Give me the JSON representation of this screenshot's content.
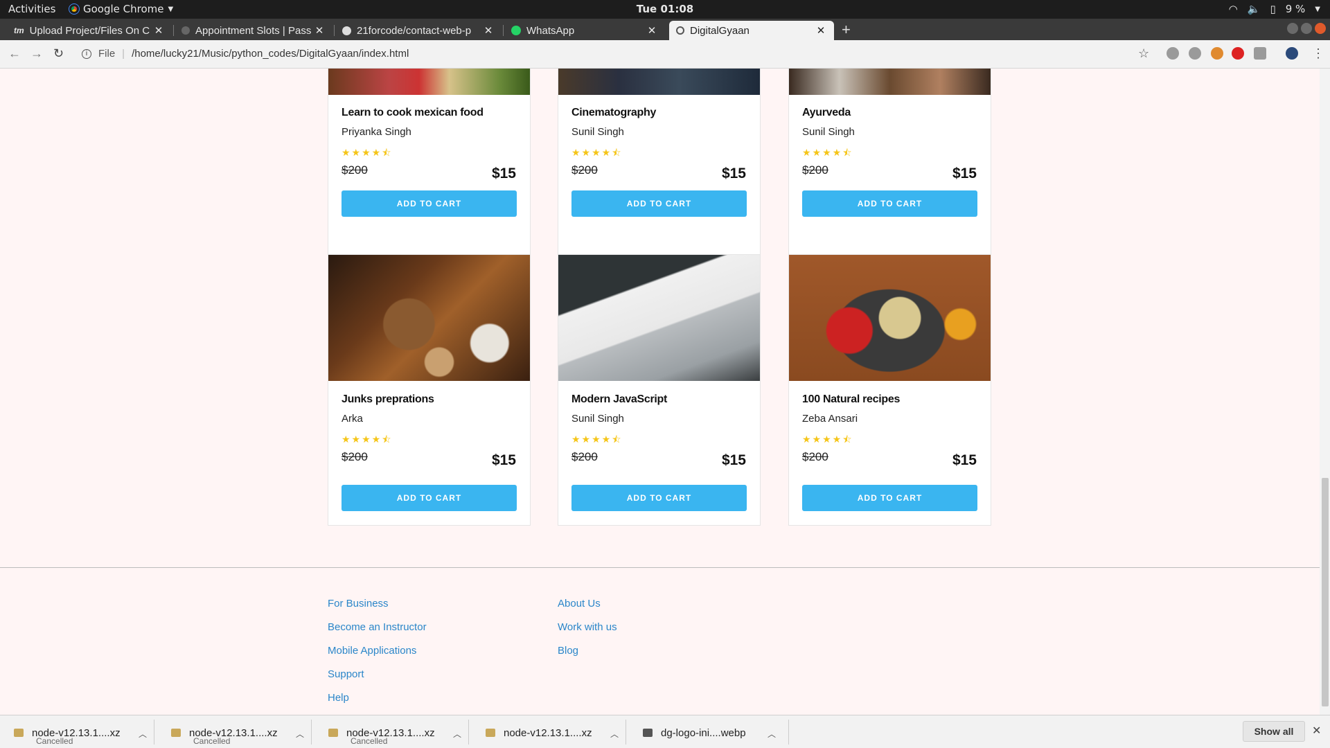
{
  "system": {
    "activities": "Activities",
    "app_name": "Google Chrome",
    "clock": "Tue 01:08",
    "battery": "9 %"
  },
  "tabs": [
    {
      "title": "Upload Project/Files On C",
      "icon": "tm-icon"
    },
    {
      "title": "Appointment Slots | Pass",
      "icon": "globe-icon"
    },
    {
      "title": "21forcode/contact-web-p",
      "icon": "github-icon"
    },
    {
      "title": "WhatsApp",
      "icon": "whatsapp-icon"
    },
    {
      "title": "DigitalGyaan",
      "icon": "globe-icon",
      "active": true
    }
  ],
  "address": {
    "scheme": "File",
    "path": "/home/lucky21/Music/python_codes/DigitalGyaan/index.html"
  },
  "courses": [
    {
      "title": "Learn to cook mexican food",
      "author": "Priyanka Singh",
      "rating": 4.5,
      "old_price": "$200",
      "price": "$15",
      "button": "ADD TO CART"
    },
    {
      "title": "Cinematography",
      "author": "Sunil Singh",
      "rating": 4.5,
      "old_price": "$200",
      "price": "$15",
      "button": "ADD TO CART"
    },
    {
      "title": "Ayurveda",
      "author": "Sunil Singh",
      "rating": 4.5,
      "old_price": "$200",
      "price": "$15",
      "button": "ADD TO CART"
    },
    {
      "title": "Junks preprations",
      "author": "Arka",
      "rating": 4.5,
      "old_price": "$200",
      "price": "$15",
      "button": "ADD TO CART"
    },
    {
      "title": "Modern JavaScript",
      "author": "Sunil Singh",
      "rating": 4.5,
      "old_price": "$200",
      "price": "$15",
      "button": "ADD TO CART"
    },
    {
      "title": "100 Natural recipes",
      "author": "Zeba Ansari",
      "rating": 4.5,
      "old_price": "$200",
      "price": "$15",
      "button": "ADD TO CART"
    }
  ],
  "stars_text": "★★★★⯪",
  "footer": {
    "col1": [
      "For Business",
      "Become an Instructor",
      "Mobile Applications",
      "Support",
      "Help"
    ],
    "col2": [
      "About Us",
      "Work with us",
      "Blog"
    ]
  },
  "downloads": [
    {
      "name": "node-v12.13.1....xz",
      "status": "Cancelled"
    },
    {
      "name": "node-v12.13.1....xz",
      "status": "Cancelled"
    },
    {
      "name": "node-v12.13.1....xz",
      "status": "Cancelled"
    },
    {
      "name": "node-v12.13.1....xz",
      "status": ""
    },
    {
      "name": "dg-logo-ini....webp",
      "status": ""
    }
  ],
  "show_all": "Show all",
  "colors": {
    "accent": "#3ab5f0",
    "link": "#2a86c9",
    "star": "#f5c518",
    "page_bg": "#fff5f5"
  }
}
